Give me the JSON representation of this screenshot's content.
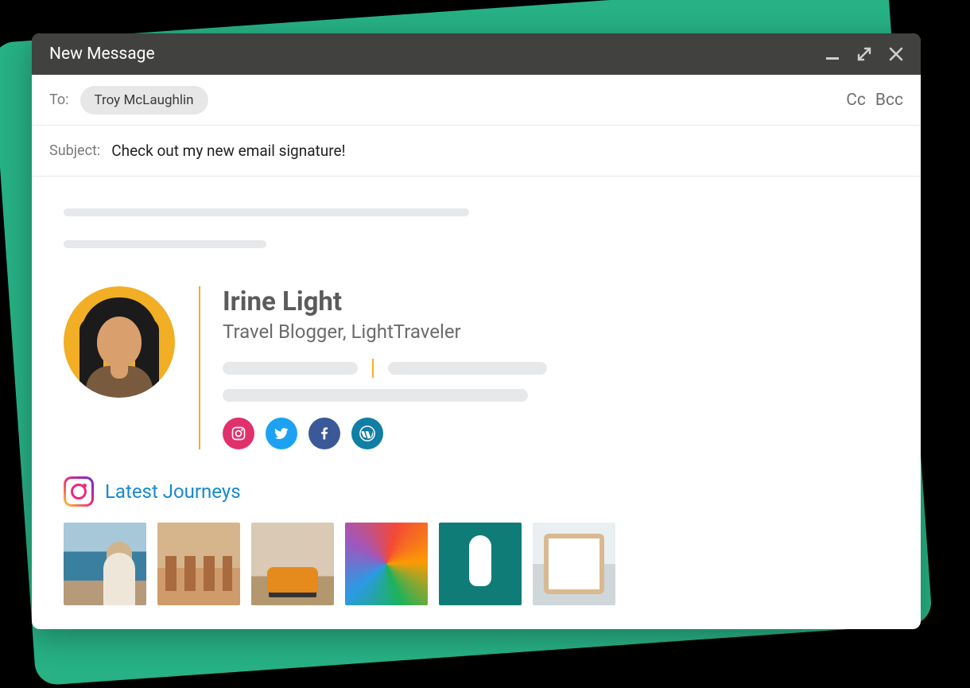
{
  "window": {
    "title": "New Message"
  },
  "to": {
    "label": "To:",
    "recipient": "Troy McLaughlin",
    "cc": "Cc",
    "bcc": "Bcc"
  },
  "subject": {
    "label": "Subject:",
    "text": "Check out my new email signature!"
  },
  "signature": {
    "name": "Irine Light",
    "title": "Travel Blogger, LightTraveler",
    "social": {
      "instagram": "instagram",
      "twitter": "twitter",
      "facebook": "facebook",
      "wordpress": "wordpress"
    }
  },
  "gallery": {
    "title": "Latest Journeys"
  }
}
